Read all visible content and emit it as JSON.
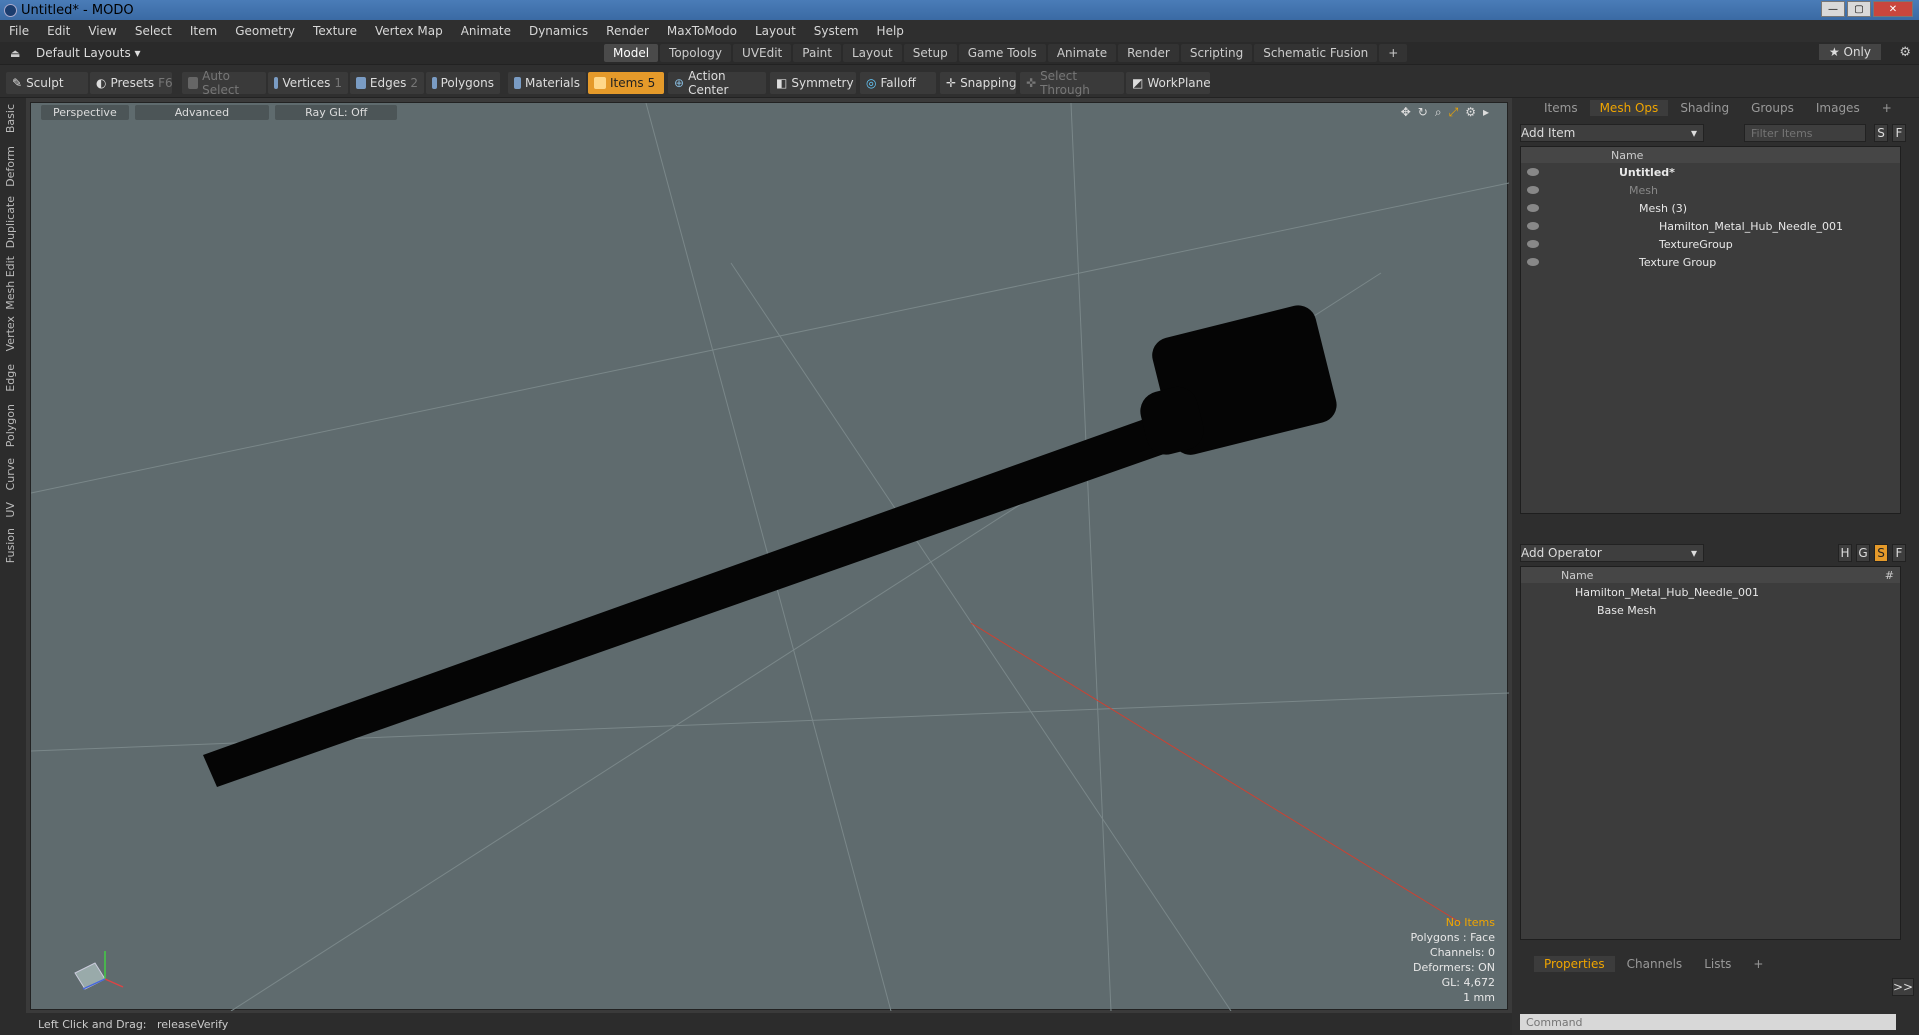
{
  "window": {
    "title": "Untitled* - MODO",
    "buttons": [
      "—",
      "▢",
      "✕"
    ]
  },
  "menu": [
    "File",
    "Edit",
    "View",
    "Select",
    "Item",
    "Geometry",
    "Texture",
    "Vertex Map",
    "Animate",
    "Dynamics",
    "Render",
    "MaxToModo",
    "Layout",
    "System",
    "Help"
  ],
  "layoutbar": {
    "layout": "Default Layouts ▾",
    "tabs": [
      "Model",
      "Topology",
      "UVEdit",
      "Paint",
      "Layout",
      "Setup",
      "Game Tools",
      "Animate",
      "Render",
      "Scripting",
      "Schematic Fusion",
      "+"
    ],
    "active_tab": "Model",
    "only": "★ Only"
  },
  "toolbar": {
    "sculpt": "Sculpt",
    "presets": "Presets",
    "presets_key": "F6",
    "auto_select": "Auto Select",
    "vertices": "Vertices",
    "vertices_key": "1",
    "edges": "Edges",
    "edges_key": "2",
    "polygons": "Polygons",
    "materials": "Materials",
    "items": "Items",
    "items_key": "5",
    "action_center": "Action Center",
    "symmetry": "Symmetry",
    "falloff": "Falloff",
    "snapping": "Snapping",
    "select_through": "Select Through",
    "workplane": "WorkPlane"
  },
  "left_tabs": [
    "Basic",
    "Deform",
    "Duplicate",
    "Mesh Edit",
    "Vertex",
    "Edge",
    "Polygon",
    "Curve",
    "UV",
    "Fusion"
  ],
  "viewport": {
    "view": "Perspective",
    "mode": "Advanced",
    "raygl": "Ray GL: Off",
    "stats": {
      "items": "No Items",
      "polygons": "Polygons : Face",
      "channels": "Channels: 0",
      "deformers": "Deformers: ON",
      "gl": "GL: 4,672",
      "unit": "1 mm"
    }
  },
  "status": "Left Click and Drag:   releaseVerify",
  "items_panel": {
    "tabs": [
      "Items",
      "Mesh Ops",
      "Shading",
      "Groups",
      "Images",
      "+"
    ],
    "active_tab": "Mesh Ops",
    "add_item": "Add Item",
    "filter_placeholder": "Filter Items",
    "s_btn": "S",
    "f_btn": "F",
    "column": "Name",
    "rows": [
      "Untitled*",
      "Mesh",
      "Mesh (3)",
      "Hamilton_Metal_Hub_Needle_001",
      "TextureGroup",
      "Texture Group"
    ]
  },
  "operator_panel": {
    "add_operator": "Add Operator",
    "column": "Name",
    "hash": "#",
    "h_btn": "H",
    "g_btn": "G",
    "s_btn": "S",
    "f_btn": "F",
    "rows": [
      "Hamilton_Metal_Hub_Needle_001",
      "Base Mesh"
    ]
  },
  "props_panel": {
    "tabs": [
      "Properties",
      "Channels",
      "Lists",
      "+"
    ],
    "active_tab": "Properties",
    "expand": ">>",
    "command_placeholder": "Command"
  },
  "colors": {
    "accent": "#f0a500",
    "viewport": "#5f6b6e",
    "axis_x": "#d04030"
  }
}
